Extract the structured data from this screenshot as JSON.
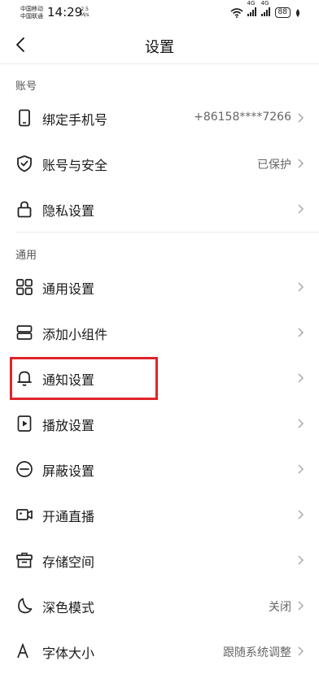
{
  "status": {
    "carrier1": "中国移动",
    "carrier2": "中国联通",
    "time": "14:29",
    "speed_value": "2.5",
    "speed_unit": "M/s",
    "network1": "4G",
    "network2": "4G",
    "battery": "88"
  },
  "header": {
    "title": "设置"
  },
  "sections": {
    "account": "账号",
    "general": "通用"
  },
  "rows": {
    "phone": {
      "label": "绑定手机号",
      "value": "+86158****7266"
    },
    "security": {
      "label": "账号与安全",
      "value": "已保护"
    },
    "privacy": {
      "label": "隐私设置"
    },
    "general_settings": {
      "label": "通用设置"
    },
    "widget": {
      "label": "添加小组件"
    },
    "notify": {
      "label": "通知设置"
    },
    "playback": {
      "label": "播放设置"
    },
    "block": {
      "label": "屏蔽设置"
    },
    "live": {
      "label": "开通直播"
    },
    "storage": {
      "label": "存储空间"
    },
    "dark": {
      "label": "深色模式",
      "value": "关闭"
    },
    "font": {
      "label": "字体大小",
      "value": "跟随系统调整"
    }
  },
  "colors": {
    "highlight": "#e0242b"
  }
}
